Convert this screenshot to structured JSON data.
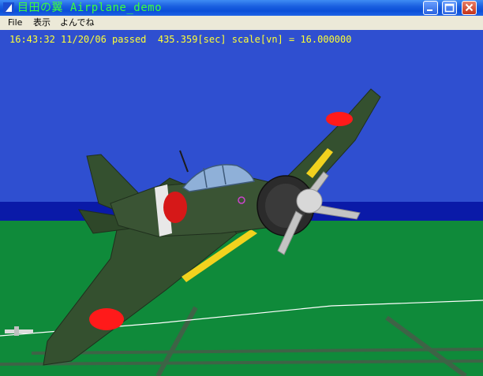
{
  "window": {
    "title": "目田の翼 Airplane_demo",
    "colors": {
      "title_text": "#3cff3c",
      "sky": "#2f4fd0",
      "horizon_band": "#0a1aa8",
      "ground": "#0f8a3a",
      "status_text": "#ffff33"
    }
  },
  "titlebar": {
    "minimize_icon": "minimize-icon",
    "maximize_icon": "maximize-icon",
    "close_icon": "close-icon"
  },
  "menubar": {
    "items": [
      {
        "label": "File"
      },
      {
        "label": "表示"
      },
      {
        "label": "よんでね"
      }
    ]
  },
  "status": {
    "text": "16:43:32 11/20/06 passed  435.359[sec] scale[vn] = 16.000000"
  }
}
